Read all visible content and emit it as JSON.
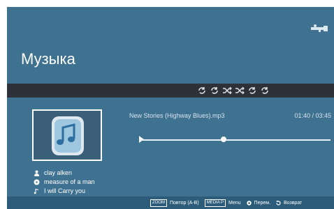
{
  "screen": {
    "title": "Музыка"
  },
  "icons": {
    "usb": "usb-icon",
    "modes": [
      "repeat-all-icon",
      "repeat-one-icon",
      "shuffle-icon",
      "shuffle-all-icon",
      "repeat-ab-icon",
      "repeat-folder-icon"
    ],
    "artist": "user-icon",
    "album": "disc-icon",
    "track": "music-note-icon"
  },
  "track": {
    "filename": "New Stories (Highway Blues).mp3",
    "elapsed": "01:40",
    "total": "03:45",
    "time_display": "01:40 / 03:45",
    "progress": 0.44
  },
  "meta": {
    "artist": "clay alken",
    "album": "measure of a man",
    "title": "I will Carry you"
  },
  "footer": {
    "zoom_key": "ZOOM",
    "zoom_label": "Повтор (A-B)",
    "media_key": "MEDIA P",
    "media_label": "Menu",
    "move_label": "Перем.",
    "back_label": "Возврат"
  },
  "colors": {
    "background": "#3f7190",
    "mode_bar": "#2f3138",
    "footer": "#2d5c7a",
    "text": "#ffffff"
  }
}
